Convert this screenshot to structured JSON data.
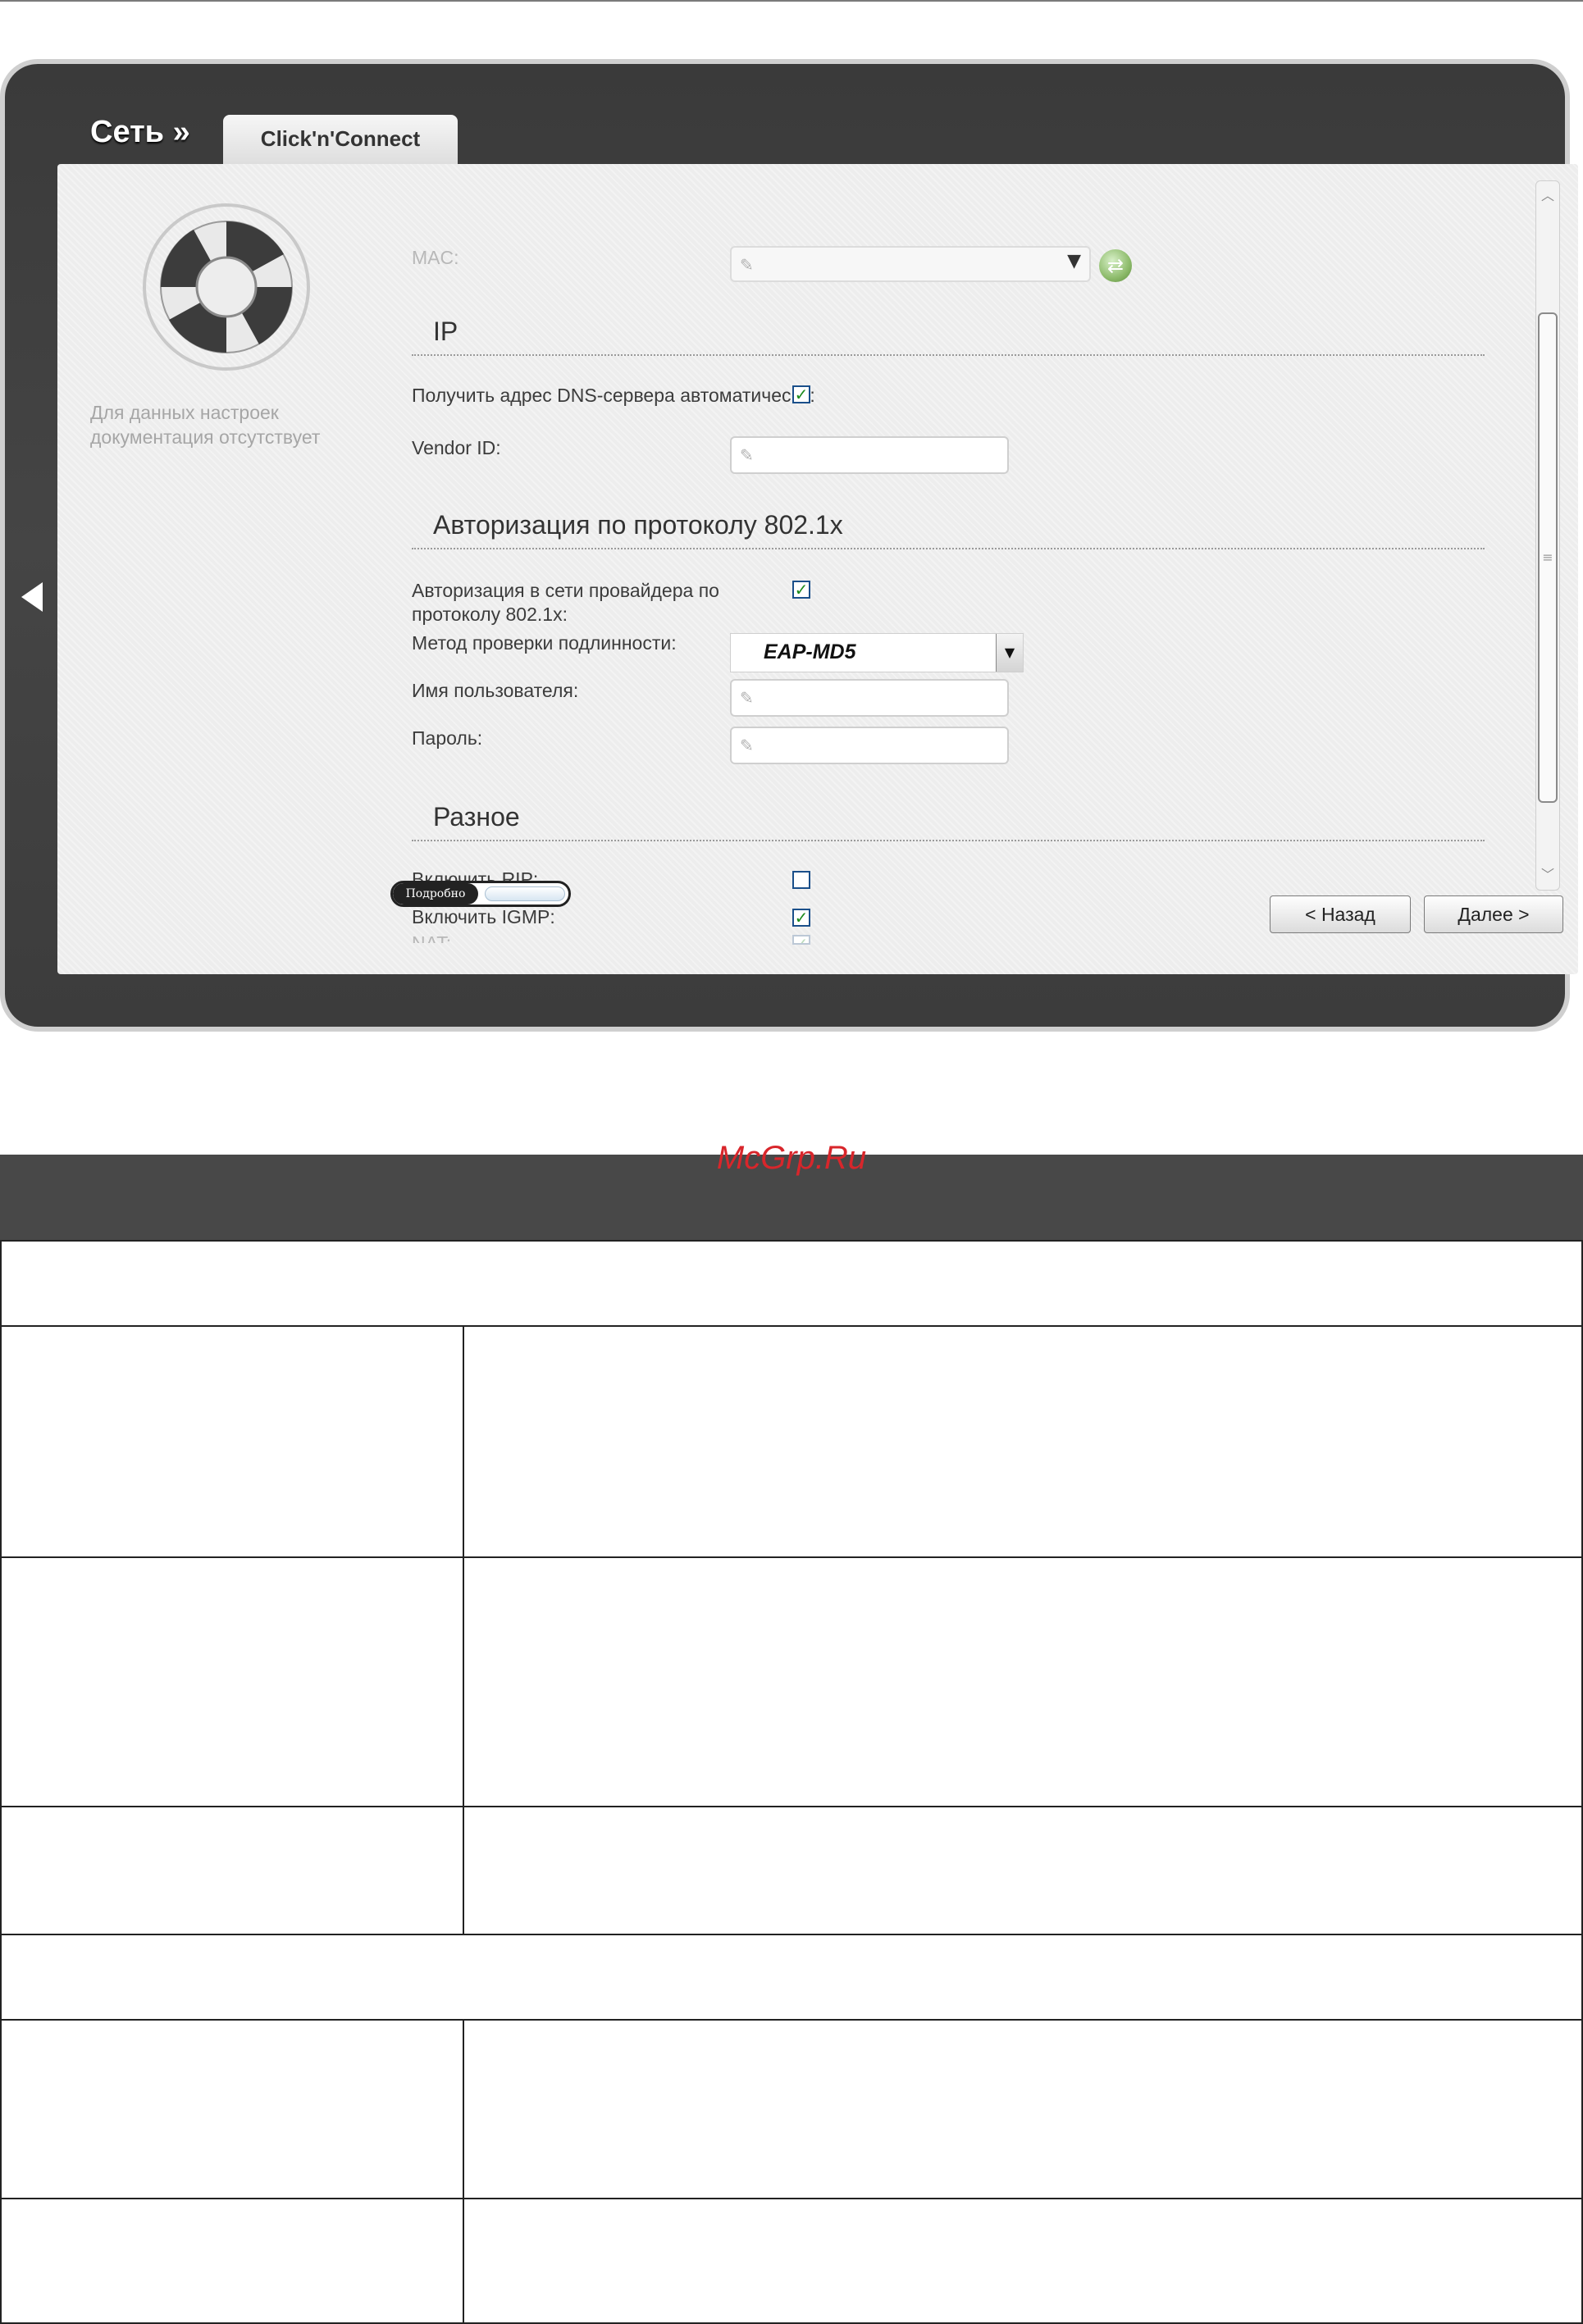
{
  "header": {
    "breadcrumb": "Сеть »",
    "tab_label": "Click'n'Connect"
  },
  "sidebar": {
    "help_text": "Для данных настроек документация отсутствует"
  },
  "mac": {
    "label": "MAC:",
    "value": ""
  },
  "sections": {
    "ip": "IP",
    "auth": "Авторизация по протоколу 802.1x",
    "misc": "Разное"
  },
  "fields": {
    "dns_auto": {
      "label": "Получить адрес DNS-сервера автоматически:",
      "checked": true
    },
    "vendor_id": {
      "label": "Vendor ID:",
      "value": ""
    },
    "auth_8021x": {
      "label": "Авторизация в сети провайдера по протоколу 802.1x:",
      "checked": true
    },
    "auth_method": {
      "label": "Метод проверки подлинности:",
      "value": "EAP-MD5"
    },
    "username": {
      "label": "Имя пользователя:",
      "value": ""
    },
    "password": {
      "label": "Пароль:",
      "value": ""
    },
    "rip": {
      "label": "Включить RIP:",
      "checked": false
    },
    "igmp": {
      "label": "Включить IGMP:",
      "checked": true
    },
    "nat": {
      "label": "NAT:",
      "checked": true
    }
  },
  "toggle": {
    "label": "Подробно"
  },
  "buttons": {
    "back": "< Назад",
    "next": "Далее >"
  },
  "watermark": "McGrp.Ru",
  "colors": {
    "panel": "#ededed",
    "frame": "#3f3f3f",
    "check": "#1c8a1c",
    "watermark": "#d8262b"
  }
}
